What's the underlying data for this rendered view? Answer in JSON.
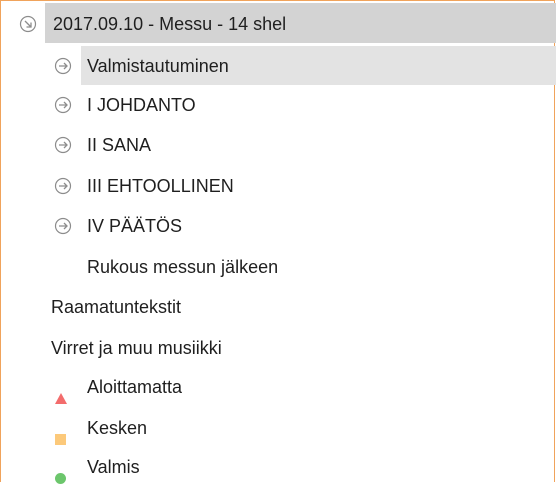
{
  "tree": {
    "root": {
      "label": "2017.09.10 - Messu - 14 shel"
    },
    "children": [
      {
        "label": "Valmistautuminen"
      },
      {
        "label": "I JOHDANTO"
      },
      {
        "label": "II SANA"
      },
      {
        "label": "III EHTOOLLINEN"
      },
      {
        "label": "IV PÄÄTÖS"
      }
    ],
    "prayer": {
      "label": "Rukous messun jälkeen"
    }
  },
  "links": {
    "scripture": "Raamatuntekstit",
    "hymns": "Virret ja muu  musiikki"
  },
  "legend": {
    "not_started": {
      "label": "Aloittamatta",
      "color": "#f36c6c"
    },
    "in_progress": {
      "label": "Kesken",
      "color": "#fcc97a"
    },
    "done": {
      "label": "Valmis",
      "color": "#6cc66c"
    }
  },
  "colors": {
    "frame_border": "#f0a35b",
    "root_highlight": "#d3d3d3",
    "item_highlight": "#e3e3e3",
    "arrow_icon": "#8c8c8c"
  }
}
